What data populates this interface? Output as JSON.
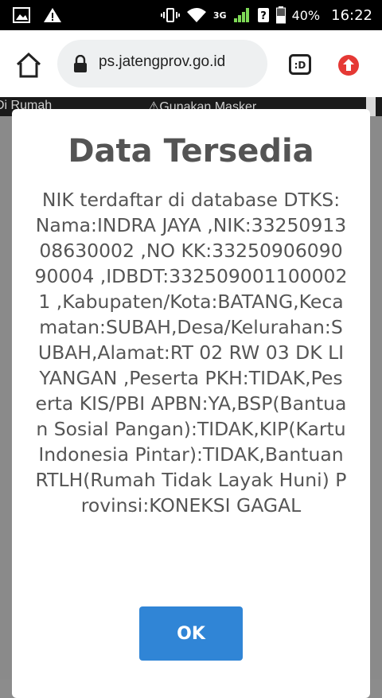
{
  "status_bar": {
    "battery_percent": "40%",
    "clock": "16:22",
    "network": "3G"
  },
  "browser": {
    "url": "ps.jatengprov.go.id",
    "tab_count_label": ":D"
  },
  "page_strip": {
    "left_text": "Di Rumah",
    "middle_text": "Gunakan Masker"
  },
  "dialog": {
    "title": "Data Tersedia",
    "body": "NIK terdaftar di database DTKS: Nama:INDRA JAYA ,NIK:3325091308630002 ,NO KK:3325090609090004 ,IDBDT:3325090011000021 ,Kabupaten/Kota:BATANG,Kecamatan:SUBAH,Desa/Kelurahan:SUBAH,Alamat:RT 02 RW 03 DK LIYANGAN ,Peserta PKH:TIDAK,Peserta KIS/PBI APBN:YA,BSP(Bantuan Sosial Pangan):TIDAK,KIP(Kartu Indonesia Pintar):TIDAK,Bantuan RTLH(Rumah Tidak Layak Huni) Provinsi:KONEKSI GAGAL",
    "ok_label": "OK"
  },
  "colors": {
    "ok_button": "#3085d6",
    "title_text": "#545454",
    "update_icon": "#e53935"
  }
}
